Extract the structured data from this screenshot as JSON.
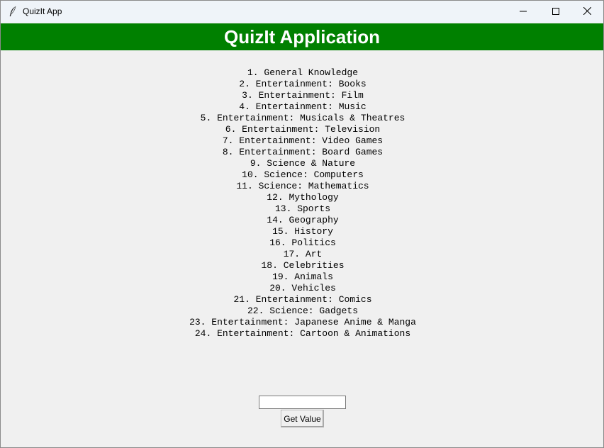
{
  "window": {
    "title": "QuizIt App"
  },
  "header": {
    "title": "QuizIt Application",
    "background": "#008000",
    "text_color": "#ffffff"
  },
  "categories": [
    "1. General Knowledge",
    "2. Entertainment: Books",
    "3. Entertainment: Film",
    "4. Entertainment: Music",
    "5. Entertainment: Musicals & Theatres",
    "6. Entertainment: Television",
    "7. Entertainment: Video Games",
    "8. Entertainment: Board Games",
    "9. Science & Nature",
    "10. Science: Computers",
    "11. Science: Mathematics",
    "12. Mythology",
    "13. Sports",
    "14. Geography",
    "15. History",
    "16. Politics",
    "17. Art",
    "18. Celebrities",
    "19. Animals",
    "20. Vehicles",
    "21. Entertainment: Comics",
    "22. Science: Gadgets",
    "23. Entertainment: Japanese Anime & Manga",
    "24. Entertainment: Cartoon & Animations"
  ],
  "input": {
    "value": ""
  },
  "button": {
    "label": "Get Value"
  },
  "icons": {
    "app": "feather-icon",
    "minimize": "minimize-icon",
    "maximize": "maximize-icon",
    "close": "close-icon"
  }
}
